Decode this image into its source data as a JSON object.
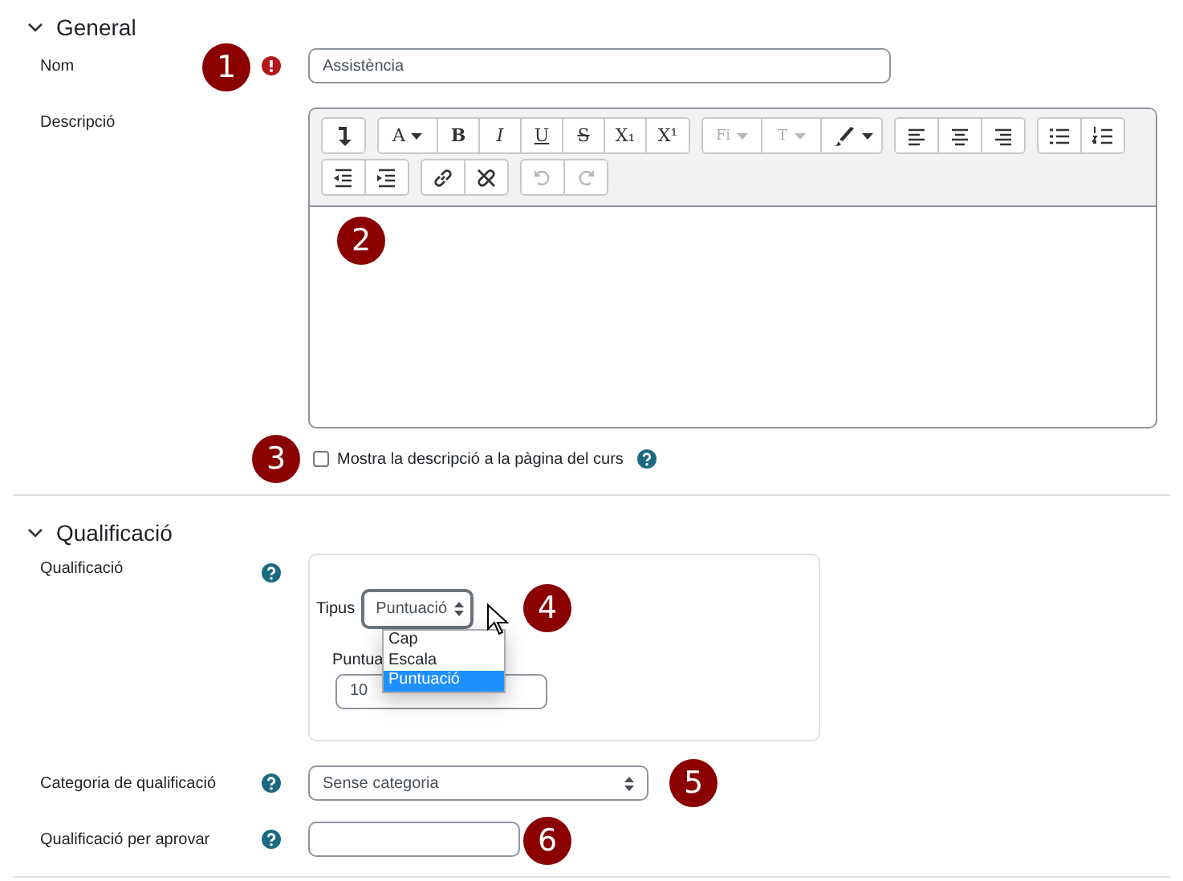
{
  "sections": [
    {
      "title": "General",
      "expanded": true,
      "fields": [
        {
          "kind": "text",
          "label": "Nom",
          "required": true,
          "value": "Assistència",
          "marker": "1"
        },
        {
          "kind": "editor",
          "label": "Descripció",
          "marker": "2",
          "toolbar": [
            [
              [
                {
                  "kind": "return"
                }
              ],
              [
                {
                  "kind": "font-color",
                  "label": "A",
                  "dropdown": true
                },
                {
                  "kind": "bold",
                  "label": "B"
                },
                {
                  "kind": "italic",
                  "label": "I"
                },
                {
                  "kind": "underline",
                  "label": "U"
                },
                {
                  "kind": "strike",
                  "label": "S"
                },
                {
                  "kind": "subscript",
                  "label": "X₁"
                },
                {
                  "kind": "superscript",
                  "label": "X¹"
                }
              ],
              [
                {
                  "kind": "font-family",
                  "label": "Fi",
                  "dropdown": true,
                  "disabled": true
                },
                {
                  "kind": "font-size",
                  "label": "T",
                  "dropdown": true,
                  "disabled": true
                },
                {
                  "kind": "brush",
                  "dropdown": true
                }
              ],
              [
                {
                  "kind": "align-left"
                },
                {
                  "kind": "align-center"
                },
                {
                  "kind": "align-right"
                }
              ],
              [
                {
                  "kind": "bullets"
                },
                {
                  "kind": "numbers"
                }
              ]
            ],
            [
              [
                {
                  "kind": "outdent"
                },
                {
                  "kind": "indent"
                }
              ],
              [
                {
                  "kind": "link"
                },
                {
                  "kind": "unlink"
                }
              ],
              [
                {
                  "kind": "undo",
                  "disabled": true
                },
                {
                  "kind": "redo",
                  "disabled": true
                }
              ]
            ]
          ]
        },
        {
          "kind": "checkbox",
          "label": "Mostra la descripció a la pàgina del curs",
          "checked": false,
          "help": true,
          "marker": "3"
        }
      ]
    },
    {
      "title": "Qualificació",
      "expanded": true,
      "fields": [
        {
          "kind": "grade",
          "label": "Qualificació",
          "help": true,
          "type_label": "Tipus",
          "type_value": "Puntuació",
          "open": true,
          "options": [
            {
              "label": "Cap",
              "selected": false
            },
            {
              "label": "Escala",
              "selected": false
            },
            {
              "label": "Puntuació",
              "selected": true
            }
          ],
          "max_label": "Puntua",
          "max_value": "10",
          "marker": "4"
        },
        {
          "kind": "select",
          "label": "Categoria de qualificació",
          "help": true,
          "value": "Sense categoria",
          "marker": "5"
        },
        {
          "kind": "text",
          "label": "Qualificació per aprovar",
          "help": true,
          "marker": "6"
        }
      ]
    }
  ]
}
